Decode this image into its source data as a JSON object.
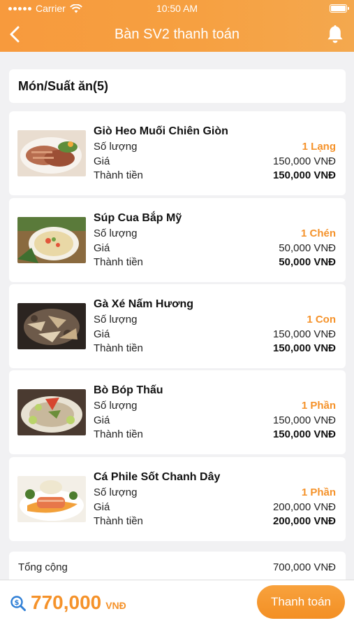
{
  "status_bar": {
    "carrier": "Carrier",
    "time": "10:50 AM"
  },
  "nav": {
    "title": "Bàn SV2 thanh toán",
    "back_icon": "chevron-left-icon",
    "bell_icon": "bell-icon"
  },
  "section": {
    "title": "Món/Suất ăn(5)"
  },
  "labels": {
    "quantity": "Số lượng",
    "price": "Giá",
    "total": "Thành tiền"
  },
  "items": [
    {
      "name": "Giò Heo Muối Chiên Giòn",
      "quantity": "1 Lạng",
      "price": "150,000 VNĐ",
      "total": "150,000 VNĐ"
    },
    {
      "name": "Súp Cua Bắp Mỹ",
      "quantity": "1 Chén",
      "price": "50,000 VNĐ",
      "total": "50,000 VNĐ"
    },
    {
      "name": "Gà Xé Nấm Hương",
      "quantity": "1 Con",
      "price": "150,000 VNĐ",
      "total": "150,000 VNĐ"
    },
    {
      "name": "Bò Bóp Thấu",
      "quantity": "1 Phần",
      "price": "150,000 VNĐ",
      "total": "150,000 VNĐ"
    },
    {
      "name": "Cá Phile Sốt Chanh Dây",
      "quantity": "1 Phần",
      "price": "200,000 VNĐ",
      "total": "200,000 VNĐ"
    }
  ],
  "summary": {
    "label": "Tổng cộng",
    "value": "700,000 VNĐ"
  },
  "footer": {
    "grand_total": "770,000",
    "currency": "VNĐ",
    "pay_label": "Thanh toán",
    "search_icon": "search-money-icon"
  },
  "colors": {
    "accent": "#f5922a",
    "header_start": "#f79a3d",
    "header_end": "#f4a84e"
  }
}
